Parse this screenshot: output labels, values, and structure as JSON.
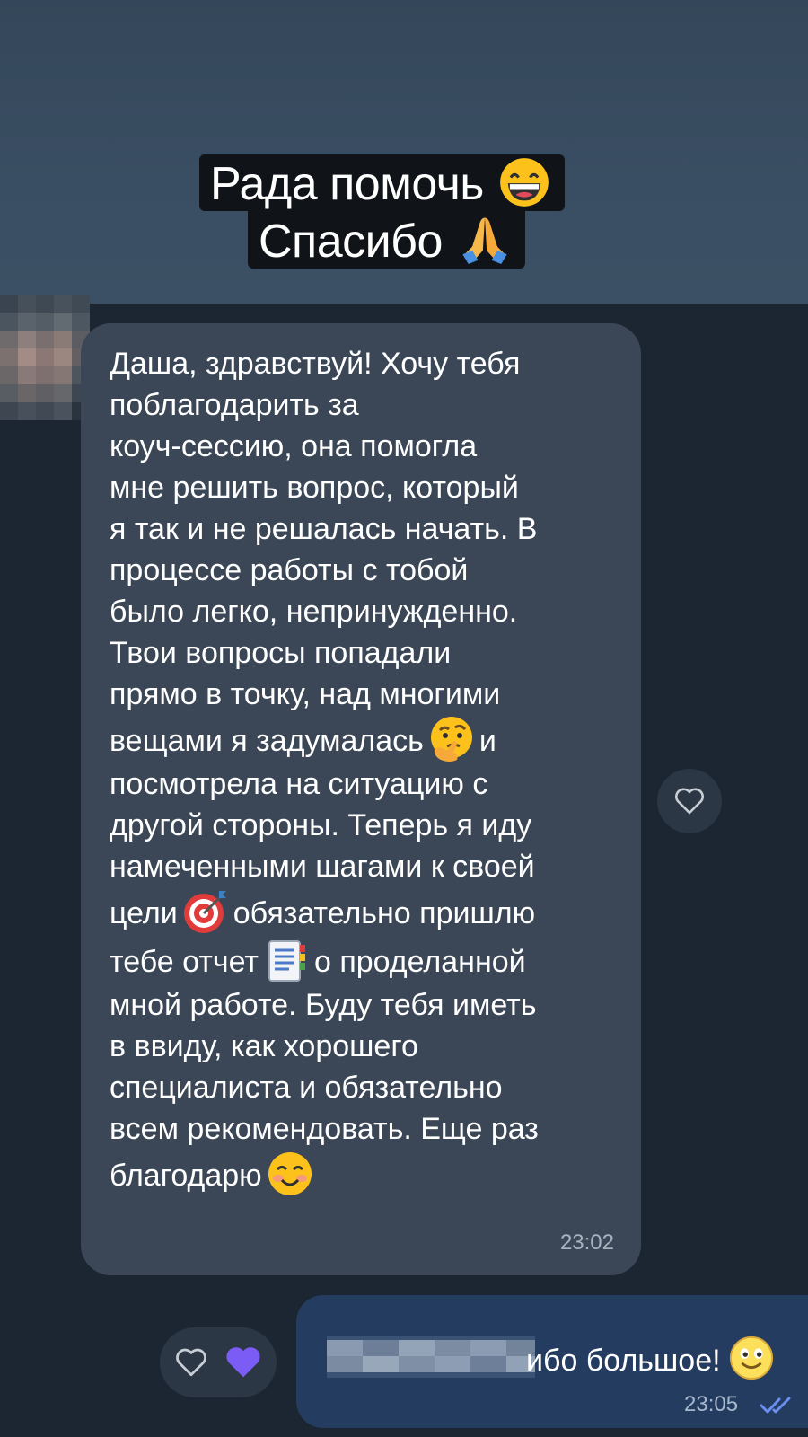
{
  "banner": {
    "caption_line_1": "Рада помочь",
    "caption_line_2": "Спасибо"
  },
  "incoming_message": {
    "lines": [
      "Даша, здравствуй! Хочу тебя",
      "поблагодарить за",
      "коуч-сессию,  она  помогла",
      "мне решить вопрос, который",
      "я так и не решалась начать. В",
      "процессе работы с тобой",
      "было легко, непринужденно.",
      "Твои вопросы попадали",
      "прямо в точку, над многими",
      "вещами я задумалась",
      "и",
      "посмотрела на ситуацию с",
      "другой стороны. Теперь я иду",
      "намеченными шагами к своей",
      "цели",
      "обязательно пришлю",
      "тебе отчет",
      "о проделанной",
      "мной работе. Буду тебя иметь",
      "в ввиду, как хорошего",
      "специалиста и обязательно",
      "всем рекомендовать. Еще раз",
      "благодарю"
    ],
    "time": "23:02"
  },
  "outgoing_message": {
    "visible_text": "ибо большое!",
    "time": "23:05"
  },
  "icons": {
    "banner_emoji_1": "grinning-face-icon",
    "banner_emoji_2": "folded-hands-icon",
    "thinking": "thinking-face-icon",
    "target": "direct-hit-icon",
    "notes": "notepad-icon",
    "smiling": "smiling-face-icon",
    "slight_smile": "slightly-smiling-face-icon",
    "heart_outline": "heart-outline-icon",
    "heart_filled": "heart-filled-icon",
    "double_check": "double-check-icon"
  },
  "colors": {
    "background": "#1b2632",
    "incoming_bubble": "#3b4756",
    "outgoing_bubble": "#243c60",
    "heart_filled": "#7b5cf5",
    "double_check": "#6a8ff0"
  }
}
